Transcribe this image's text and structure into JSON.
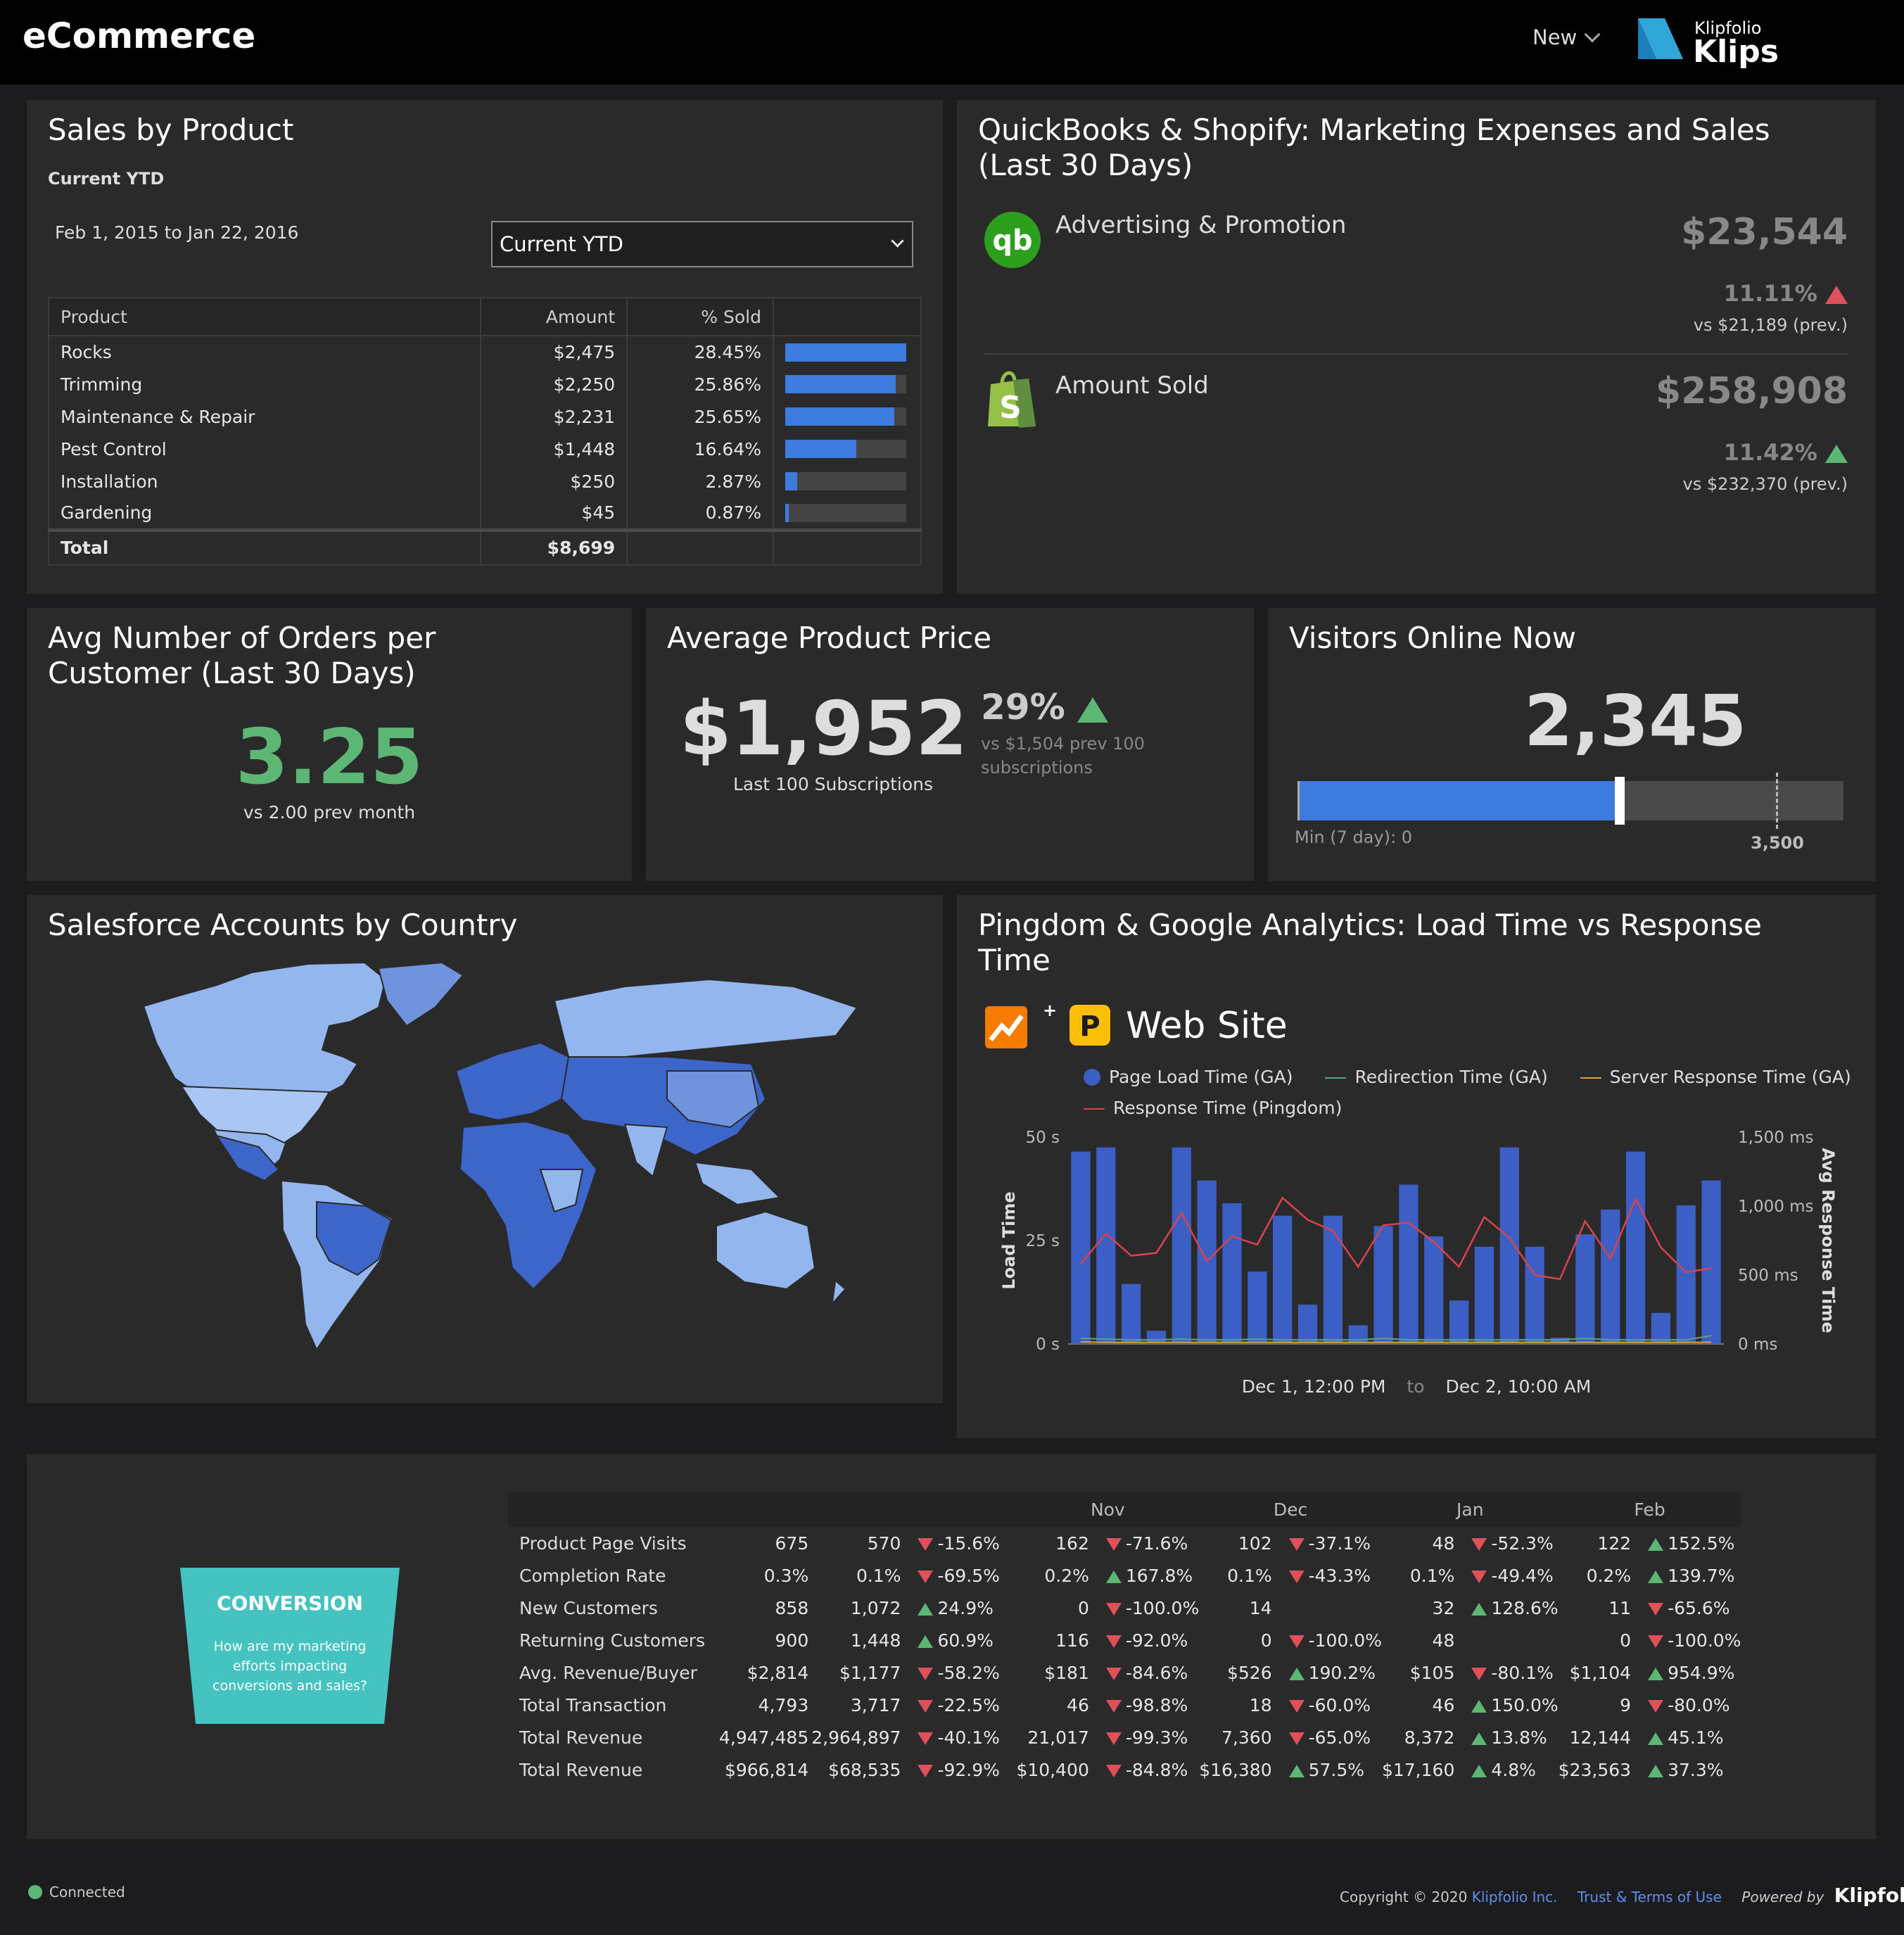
{
  "app": {
    "title": "eCommerce",
    "new_label": "New",
    "brand_small": "Klipfolio",
    "brand_big": "Klips"
  },
  "sales": {
    "title": "Sales by Product",
    "subtitle": "Current YTD",
    "date_range": "Feb 1, 2015 to Jan 22, 2016",
    "select_value": "Current YTD",
    "columns": [
      "Product",
      "Amount",
      "% Sold"
    ],
    "rows": [
      {
        "product": "Rocks",
        "amount": "$2,475",
        "pct": "28.45%",
        "ratio": 1.0
      },
      {
        "product": "Trimming",
        "amount": "$2,250",
        "pct": "25.86%",
        "ratio": 0.91
      },
      {
        "product": "Maintenance & Repair",
        "amount": "$2,231",
        "pct": "25.65%",
        "ratio": 0.9
      },
      {
        "product": "Pest Control",
        "amount": "$1,448",
        "pct": "16.64%",
        "ratio": 0.59
      },
      {
        "product": "Installation",
        "amount": "$250",
        "pct": "2.87%",
        "ratio": 0.1
      },
      {
        "product": "Gardening",
        "amount": "$45",
        "pct": "0.87%",
        "ratio": 0.03
      }
    ],
    "total_label": "Total",
    "total_amount": "$8,699"
  },
  "qb": {
    "title_line1": "QuickBooks & Shopify: Marketing Expenses and Sales",
    "title_line2": "(Last 30 Days)",
    "ad_label": "Advertising & Promotion",
    "ad_value": "$23,544",
    "ad_change": "11.11%",
    "ad_prev": "vs $21,189 (prev.)",
    "sold_label": "Amount Sold",
    "sold_value": "$258,908",
    "sold_change": "11.42%",
    "sold_prev": "vs $232,370 (prev.)"
  },
  "orders": {
    "title_line1": "Avg Number of Orders per",
    "title_line2": "Customer (Last 30 Days)",
    "value": "3.25",
    "caption": "vs 2.00 prev month"
  },
  "price": {
    "title": "Average Product Price",
    "value": "$1,952",
    "caption": "Last 100 Subscriptions",
    "change": "29%",
    "prev_line1": "vs $1,504 prev 100",
    "prev_line2": "subscriptions"
  },
  "visitors": {
    "title": "Visitors Online Now",
    "value": "2,345",
    "min_label": "Min (7 day): 0",
    "target_label": "3,500",
    "fill_fraction": 0.586,
    "target_fraction": 0.873
  },
  "map": {
    "title": "Salesforce Accounts by Country"
  },
  "pingdom": {
    "title_line1": "Pingdom & Google Analytics: Load Time vs Response",
    "title_line2": "Time",
    "site": "Web Site",
    "plus": "+",
    "range_from": "Dec 1, 12:00 PM",
    "range_to_word": "to",
    "range_to": "Dec 2, 10:00 AM"
  },
  "chart_data": {
    "type": "bar",
    "legend": [
      "Page Load Time (GA)",
      "Redirection Time (GA)",
      "Server Response Time (GA)",
      "Response Time (Pingdom)"
    ],
    "y_left_label": "Load Time",
    "y_left_ticks": [
      "50 s",
      "25 s",
      "0 s"
    ],
    "y_left_lim": [
      0,
      50
    ],
    "y_right_label": "Avg Response Time",
    "y_right_ticks": [
      "1,500 ms",
      "1,000 ms",
      "500 ms",
      "0 ms"
    ],
    "y_right_lim": [
      0,
      1500
    ],
    "series": [
      {
        "name": "Page Load Time (GA)",
        "color": "#3b5fc4",
        "values": [
          46.5,
          47.5,
          14.5,
          3.2,
          47.5,
          39.5,
          34,
          17.5,
          31,
          9.5,
          31,
          4.5,
          28.5,
          38.5,
          26,
          10.5,
          23.5,
          47.5,
          23.5,
          1.5,
          26.5,
          32.5,
          46.5,
          7.5,
          33.5,
          39.5
        ]
      },
      {
        "name": "Response Time (Pingdom)",
        "color": "#d8434f",
        "values": [
          580,
          800,
          640,
          660,
          950,
          600,
          780,
          720,
          1060,
          900,
          820,
          560,
          860,
          880,
          740,
          560,
          920,
          770,
          500,
          470,
          890,
          620,
          1050,
          700,
          520,
          550
        ]
      },
      {
        "name": "Redirection Time (GA)",
        "color": "#5aa58a",
        "values": [
          40,
          35,
          30,
          30,
          35,
          30,
          30,
          35,
          30,
          30,
          30,
          30,
          40,
          30,
          30,
          30,
          30,
          30,
          30,
          30,
          40,
          30,
          30,
          30,
          30,
          60
        ]
      },
      {
        "name": "Server Response Time (GA)",
        "color": "#d8a03e",
        "values": [
          15,
          12,
          12,
          12,
          12,
          12,
          12,
          12,
          12,
          12,
          12,
          12,
          12,
          12,
          12,
          12,
          12,
          12,
          12,
          12,
          12,
          12,
          12,
          12,
          12,
          12
        ]
      }
    ]
  },
  "conversion": {
    "badge_title": "CONVERSION",
    "badge_text": [
      "How are my marketing",
      "efforts impacting",
      "conversions and sales?"
    ],
    "months": [
      "Nov",
      "Dec",
      "Jan",
      "Feb"
    ],
    "rows": [
      {
        "label": "Product Page Visits",
        "base": "675",
        "cells": [
          {
            "v": "570",
            "c": "-15.6%",
            "d": "down"
          },
          {
            "v": "162",
            "c": "-71.6%",
            "d": "down"
          },
          {
            "v": "102",
            "c": "-37.1%",
            "d": "down"
          },
          {
            "v": "48",
            "c": "-52.3%",
            "d": "down"
          },
          {
            "v": "122",
            "c": "152.5%",
            "d": "up"
          }
        ]
      },
      {
        "label": "Completion Rate",
        "base": "0.3%",
        "cells": [
          {
            "v": "0.1%",
            "c": "-69.5%",
            "d": "down"
          },
          {
            "v": "0.2%",
            "c": "167.8%",
            "d": "up"
          },
          {
            "v": "0.1%",
            "c": "-43.3%",
            "d": "down"
          },
          {
            "v": "0.1%",
            "c": "-49.4%",
            "d": "down"
          },
          {
            "v": "0.2%",
            "c": "139.7%",
            "d": "up"
          }
        ]
      },
      {
        "label": "New Customers",
        "base": "858",
        "cells": [
          {
            "v": "1,072",
            "c": "24.9%",
            "d": "up"
          },
          {
            "v": "0",
            "c": "-100.0%",
            "d": "down"
          },
          {
            "v": "14",
            "c": "",
            "d": ""
          },
          {
            "v": "32",
            "c": "128.6%",
            "d": "up"
          },
          {
            "v": "11",
            "c": "-65.6%",
            "d": "down"
          }
        ]
      },
      {
        "label": "Returning Customers",
        "base": "900",
        "cells": [
          {
            "v": "1,448",
            "c": "60.9%",
            "d": "up"
          },
          {
            "v": "116",
            "c": "-92.0%",
            "d": "down"
          },
          {
            "v": "0",
            "c": "-100.0%",
            "d": "down"
          },
          {
            "v": "48",
            "c": "",
            "d": ""
          },
          {
            "v": "0",
            "c": "-100.0%",
            "d": "down"
          }
        ]
      },
      {
        "label": "Avg. Revenue/Buyer",
        "base": "$2,814",
        "cells": [
          {
            "v": "$1,177",
            "c": "-58.2%",
            "d": "down"
          },
          {
            "v": "$181",
            "c": "-84.6%",
            "d": "down"
          },
          {
            "v": "$526",
            "c": "190.2%",
            "d": "up"
          },
          {
            "v": "$105",
            "c": "-80.1%",
            "d": "down"
          },
          {
            "v": "$1,104",
            "c": "954.9%",
            "d": "up"
          }
        ]
      },
      {
        "label": "Total Transaction",
        "base": "4,793",
        "cells": [
          {
            "v": "3,717",
            "c": "-22.5%",
            "d": "down"
          },
          {
            "v": "46",
            "c": "-98.8%",
            "d": "down"
          },
          {
            "v": "18",
            "c": "-60.0%",
            "d": "down"
          },
          {
            "v": "46",
            "c": "150.0%",
            "d": "up"
          },
          {
            "v": "9",
            "c": "-80.0%",
            "d": "down"
          }
        ]
      },
      {
        "label": "Total Revenue",
        "base": "4,947,485",
        "cells": [
          {
            "v": "2,964,897",
            "c": "-40.1%",
            "d": "down"
          },
          {
            "v": "21,017",
            "c": "-99.3%",
            "d": "down"
          },
          {
            "v": "7,360",
            "c": "-65.0%",
            "d": "down"
          },
          {
            "v": "8,372",
            "c": "13.8%",
            "d": "up"
          },
          {
            "v": "12,144",
            "c": "45.1%",
            "d": "up"
          }
        ]
      },
      {
        "label": "Total Revenue",
        "base": "$966,814",
        "cells": [
          {
            "v": "$68,535",
            "c": "-92.9%",
            "d": "down"
          },
          {
            "v": "$10,400",
            "c": "-84.8%",
            "d": "down"
          },
          {
            "v": "$16,380",
            "c": "57.5%",
            "d": "up"
          },
          {
            "v": "$17,160",
            "c": "4.8%",
            "d": "up"
          },
          {
            "v": "$23,563",
            "c": "37.3%",
            "d": "up"
          }
        ]
      }
    ]
  },
  "footer": {
    "status": "Connected",
    "copyright": "Copyright © 2020",
    "company": "Klipfolio Inc.",
    "terms": "Trust & Terms of Use",
    "powered": "Powered by",
    "powered_brand": "Klipfolio"
  },
  "colors": {
    "accent_blue": "#3d7bde",
    "up_green": "#5cb774",
    "down_red": "#e0505b",
    "panel": "#2a2a2b"
  }
}
